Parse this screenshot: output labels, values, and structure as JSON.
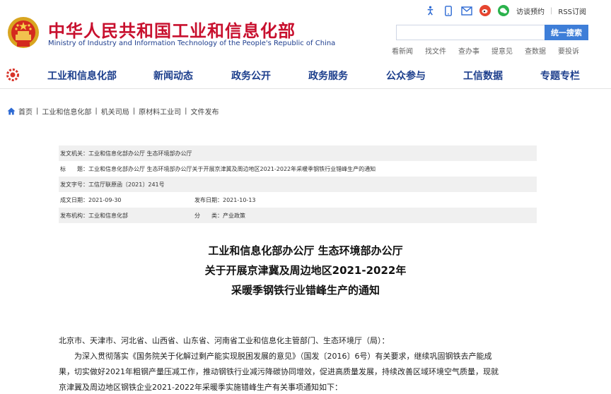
{
  "header": {
    "title_cn": "中华人民共和国工业和信息化部",
    "title_en": "Ministry of Industry and Information Technology of the People's Republic of China",
    "appointment": "访谈预约",
    "rss": "RSS订阅",
    "search_placeholder": "",
    "search_button": "统一搜索",
    "quick_links": [
      "看新闻",
      "找文件",
      "查办事",
      "提意见",
      "查数据",
      "要投诉"
    ]
  },
  "nav": {
    "items": [
      "工业和信息化部",
      "新闻动态",
      "政务公开",
      "政务服务",
      "公众参与",
      "工信数据",
      "专题专栏"
    ]
  },
  "breadcrumb": [
    "首页",
    "工业和信息化部",
    "机关司局",
    "原材料工业司",
    "文件发布"
  ],
  "info": {
    "issuer_label": "发文机关：",
    "issuer": "工业和信息化部办公厅 生态环境部办公厅",
    "title_label": "标　　题：",
    "title": "工业和信息化部办公厅 生态环境部办公厅关于开展京津冀及周边地区2021-2022年采暖季钢铁行业错峰生产的通知",
    "doc_no_label": "发文字号：",
    "doc_no": "工信厅联原函〔2021〕241号",
    "date_label": "成文日期：",
    "date": "2021-09-30",
    "publish_label": "发布日期：",
    "publish": "2021-10-13",
    "org_label": "发布机构：",
    "org": "工业和信息化部",
    "category_label": "分　　类：",
    "category": "产业政策"
  },
  "doc": {
    "title_line1": "工业和信息化部办公厅 生态环境部办公厅",
    "title_line2": "关于开展京津冀及周边地区2021-2022年",
    "title_line3": "采暖季钢铁行业错峰生产的通知",
    "addressee": "北京市、天津市、河北省、山西省、山东省、河南省工业和信息化主管部门、生态环境厅（局）：",
    "para1": "为深入贯彻落实《国务院关于化解过剩产能实现脱困发展的意见》（国发〔2016〕6号）有关要求，继续巩固钢铁去产能成",
    "para2": "果，切实做好2021年粗钢产量压减工作，推动钢铁行业减污降碳协同增效，促进高质量发展，持续改善区域环境空气质量，现就",
    "para3": "京津冀及周边地区钢铁企业2021-2022年采暖季实施错峰生产有关事项通知如下："
  },
  "colors": {
    "brand_red": "#c8102e",
    "nav_blue": "#1c3e8c",
    "search_blue": "#3e7ed8"
  }
}
